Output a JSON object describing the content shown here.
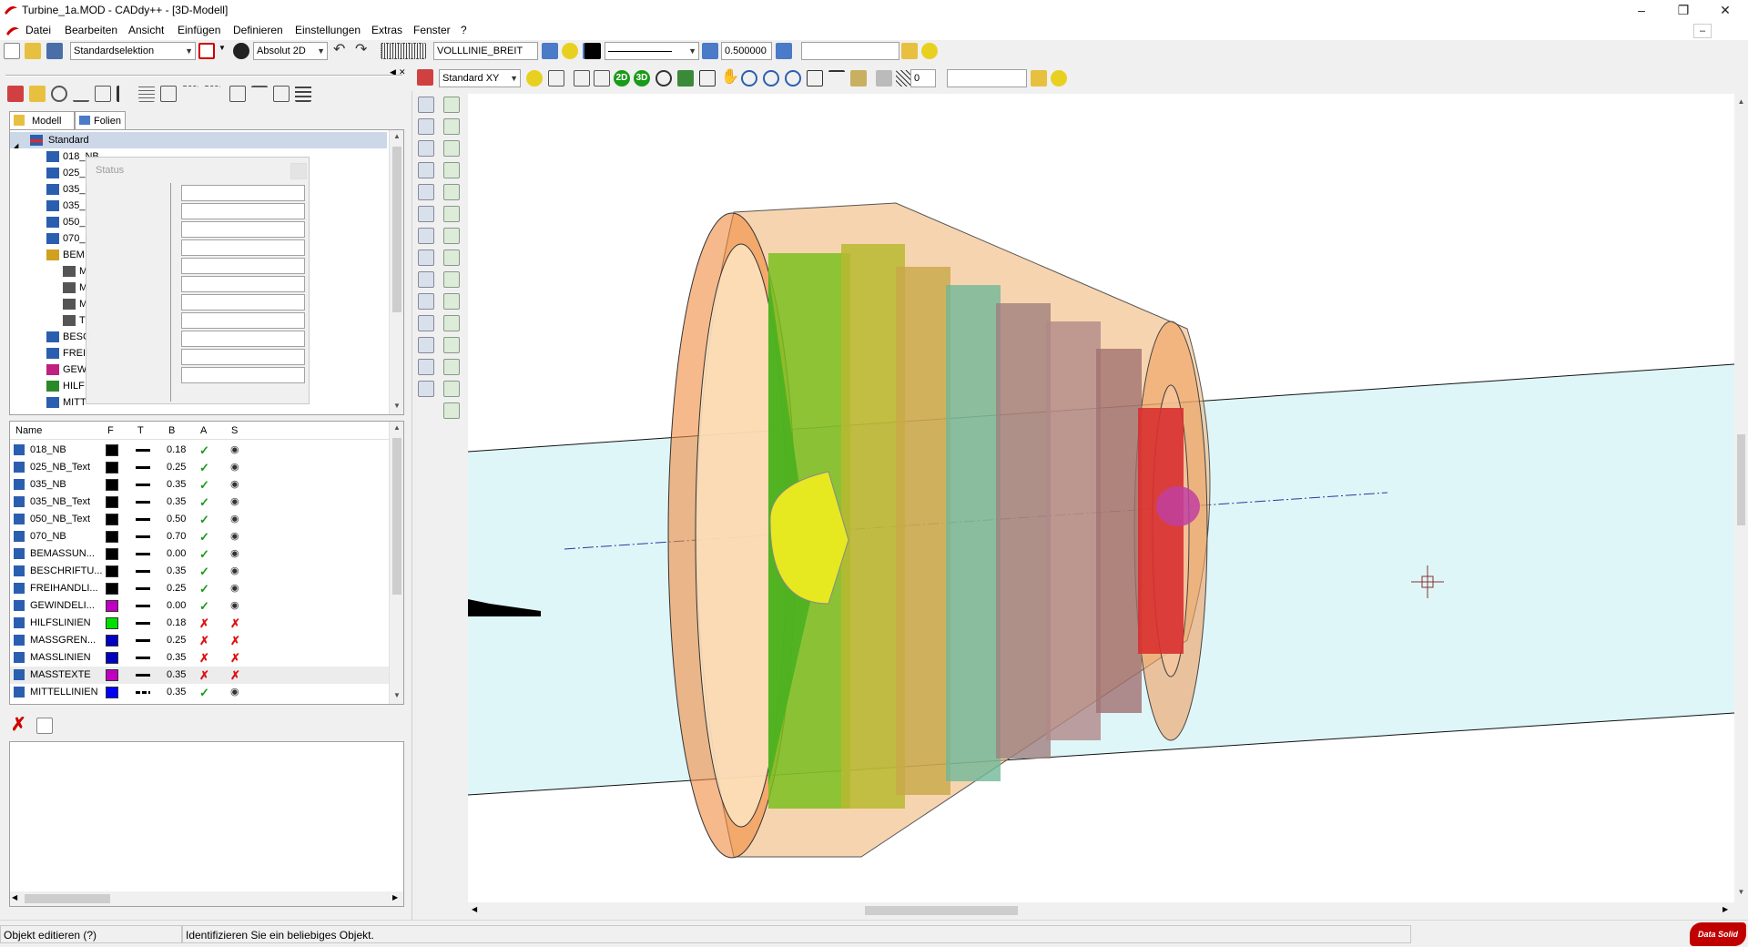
{
  "window": {
    "title": "Turbine_1a.MOD  -  CADdy++ - [3D-Modell]"
  },
  "menu": [
    "Datei",
    "Bearbeiten",
    "Ansicht",
    "Einfügen",
    "Definieren",
    "Einstellungen",
    "Extras",
    "Fenster",
    "?"
  ],
  "toolbar1": {
    "selection_mode": "Standardselektion",
    "coord_mode": "Absolut 2D",
    "linetype": "VOLLLINIE_BREIT",
    "linewidth": "0.500000",
    "text_field": ""
  },
  "toolbar2": {
    "view": "Standard XY",
    "btn_2d": "2D",
    "btn_3d": "3D",
    "layer_value": "0",
    "text_field": ""
  },
  "panel_tabs": [
    "Modell",
    "Folien"
  ],
  "tree": {
    "root": "Standard",
    "items": [
      "018_NB",
      "025_I",
      "035_I",
      "035_I",
      "050_I",
      "070_I",
      "BEM",
      "M",
      "M",
      "M",
      "T",
      "BESC",
      "FREII",
      "GEW",
      "HILF",
      "MITT"
    ]
  },
  "status_popup": {
    "title": "Status",
    "fields": [
      "",
      "",
      "",
      "",
      "",
      "",
      "",
      "",
      "",
      "",
      ""
    ]
  },
  "layer_table": {
    "columns": [
      "Name",
      "F",
      "T",
      "B",
      "A",
      "S"
    ],
    "rows": [
      {
        "name": "018_NB",
        "color": "#000000",
        "style": "solid",
        "width": "0.18",
        "active": "check",
        "visible": "eye"
      },
      {
        "name": "025_NB_Text",
        "color": "#000000",
        "style": "solid",
        "width": "0.25",
        "active": "check",
        "visible": "eye"
      },
      {
        "name": "035_NB",
        "color": "#000000",
        "style": "solid",
        "width": "0.35",
        "active": "check",
        "visible": "eye"
      },
      {
        "name": "035_NB_Text",
        "color": "#000000",
        "style": "solid",
        "width": "0.35",
        "active": "check",
        "visible": "eye"
      },
      {
        "name": "050_NB_Text",
        "color": "#000000",
        "style": "solid",
        "width": "0.50",
        "active": "check",
        "visible": "eye"
      },
      {
        "name": "070_NB",
        "color": "#000000",
        "style": "solid",
        "width": "0.70",
        "active": "check",
        "visible": "eye"
      },
      {
        "name": "BEMASSUN...",
        "color": "#000000",
        "style": "solid",
        "width": "0.00",
        "active": "check",
        "visible": "eye"
      },
      {
        "name": "BESCHRIFTU...",
        "color": "#000000",
        "style": "solid",
        "width": "0.35",
        "active": "check",
        "visible": "eye"
      },
      {
        "name": "FREIHANDLI...",
        "color": "#000000",
        "style": "solid",
        "width": "0.25",
        "active": "check",
        "visible": "eye"
      },
      {
        "name": "GEWINDELI...",
        "color": "#c000c0",
        "style": "solid",
        "width": "0.00",
        "active": "check",
        "visible": "eye"
      },
      {
        "name": "HILFSLINIEN",
        "color": "#00e000",
        "style": "solid",
        "width": "0.18",
        "active": "cross",
        "visible": "hidden"
      },
      {
        "name": "MASSGREN...",
        "color": "#0000c0",
        "style": "solid",
        "width": "0.25",
        "active": "cross",
        "visible": "hidden"
      },
      {
        "name": "MASSLINIEN",
        "color": "#0000c0",
        "style": "solid",
        "width": "0.35",
        "active": "cross",
        "visible": "hidden"
      },
      {
        "name": "MASSTEXTE",
        "color": "#c000c0",
        "style": "solid",
        "width": "0.35",
        "active": "cross",
        "visible": "hidden"
      },
      {
        "name": "MITTELLINIEN",
        "color": "#0000ff",
        "style": "dashdot",
        "width": "0.35",
        "active": "check",
        "visible": "eye"
      }
    ]
  },
  "statusbar": {
    "mode": "Objekt editieren (?)",
    "message": "Identifizieren Sie ein beliebiges Objekt.",
    "brand": "Data Solid"
  },
  "colors": {
    "accent_red": "#d00000",
    "canvas_bg": "#ffffff",
    "cylinder": "#dff6f8"
  }
}
